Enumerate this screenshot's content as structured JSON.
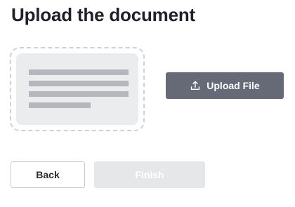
{
  "page": {
    "title": "Upload the document"
  },
  "dropzone": {
    "preview_icon": "document-preview-icon"
  },
  "actions": {
    "upload_label": "Upload File",
    "upload_icon": "upload-icon",
    "back_label": "Back",
    "finish_label": "Finish",
    "finish_disabled": true
  },
  "colors": {
    "primary_button": "#666a77",
    "disabled_button": "#e6e7e9",
    "dropzone_border": "#cfd1d6",
    "title_text": "#1f2128"
  }
}
